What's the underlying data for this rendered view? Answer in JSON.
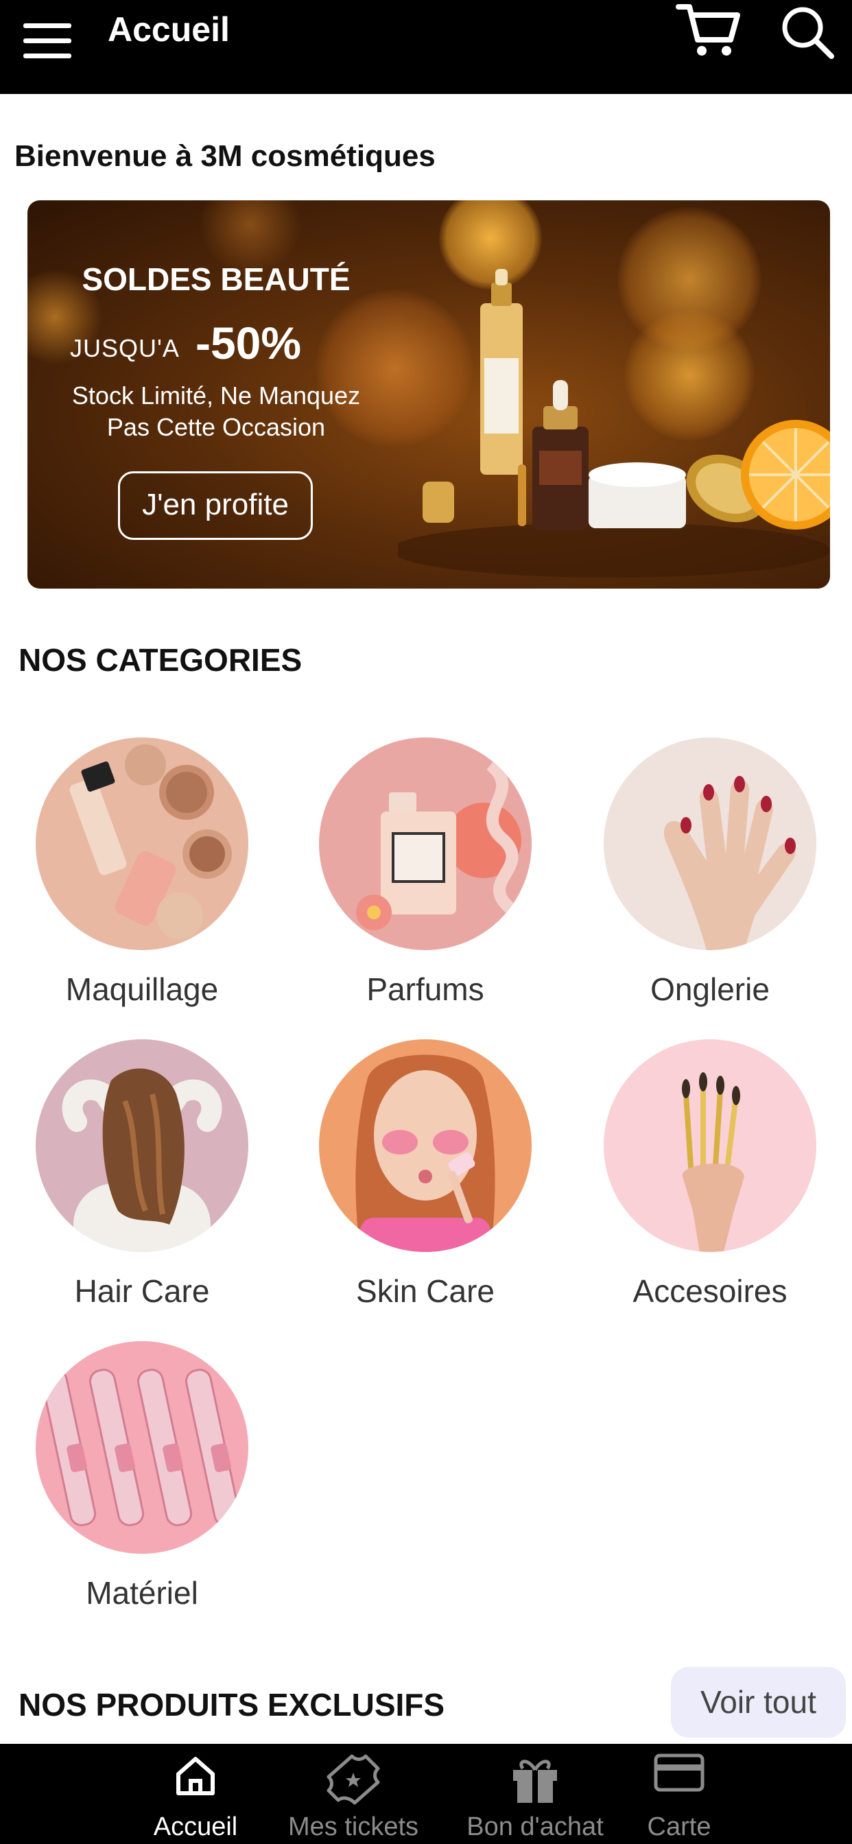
{
  "app_bar": {
    "title": "Accueil",
    "icons": [
      "menu-icon",
      "cart-icon",
      "search-icon"
    ]
  },
  "welcome_text": "Bienvenue à 3M cosmétiques",
  "banner": {
    "title": "SOLDES BEAUTÉ",
    "discount_prefix": "JUSQU'A",
    "discount_value": "-50%",
    "subtitle_line1": "Stock Limité, Ne Manquez",
    "subtitle_line2": "Pas Cette Occasion",
    "cta_label": "J'en profite"
  },
  "categories_section": {
    "title": "NOS CATEGORIES",
    "items": [
      {
        "label": "Maquillage"
      },
      {
        "label": "Parfums"
      },
      {
        "label": "Onglerie"
      },
      {
        "label": "Hair Care"
      },
      {
        "label": "Skin Care"
      },
      {
        "label": "Accesoires"
      },
      {
        "label": "Matériel"
      }
    ]
  },
  "exclusive_section": {
    "title": "NOS PRODUITS EXCLUSIFS",
    "see_all_label": "Voir tout"
  },
  "bottom_nav": {
    "items": [
      {
        "label": "Accueil",
        "icon": "home-icon",
        "active": true
      },
      {
        "label": "Mes tickets",
        "icon": "ticket-icon",
        "active": false
      },
      {
        "label": "Bon d'achat",
        "icon": "gift-icon",
        "active": false
      },
      {
        "label": "Carte",
        "icon": "card-icon",
        "active": false
      }
    ]
  },
  "colors": {
    "app_bar": "#000000",
    "bottom_nav": "#000000",
    "nav_active": "#ffffff",
    "nav_inactive": "#8c8c8c",
    "see_all_bg": "#ececfa"
  }
}
